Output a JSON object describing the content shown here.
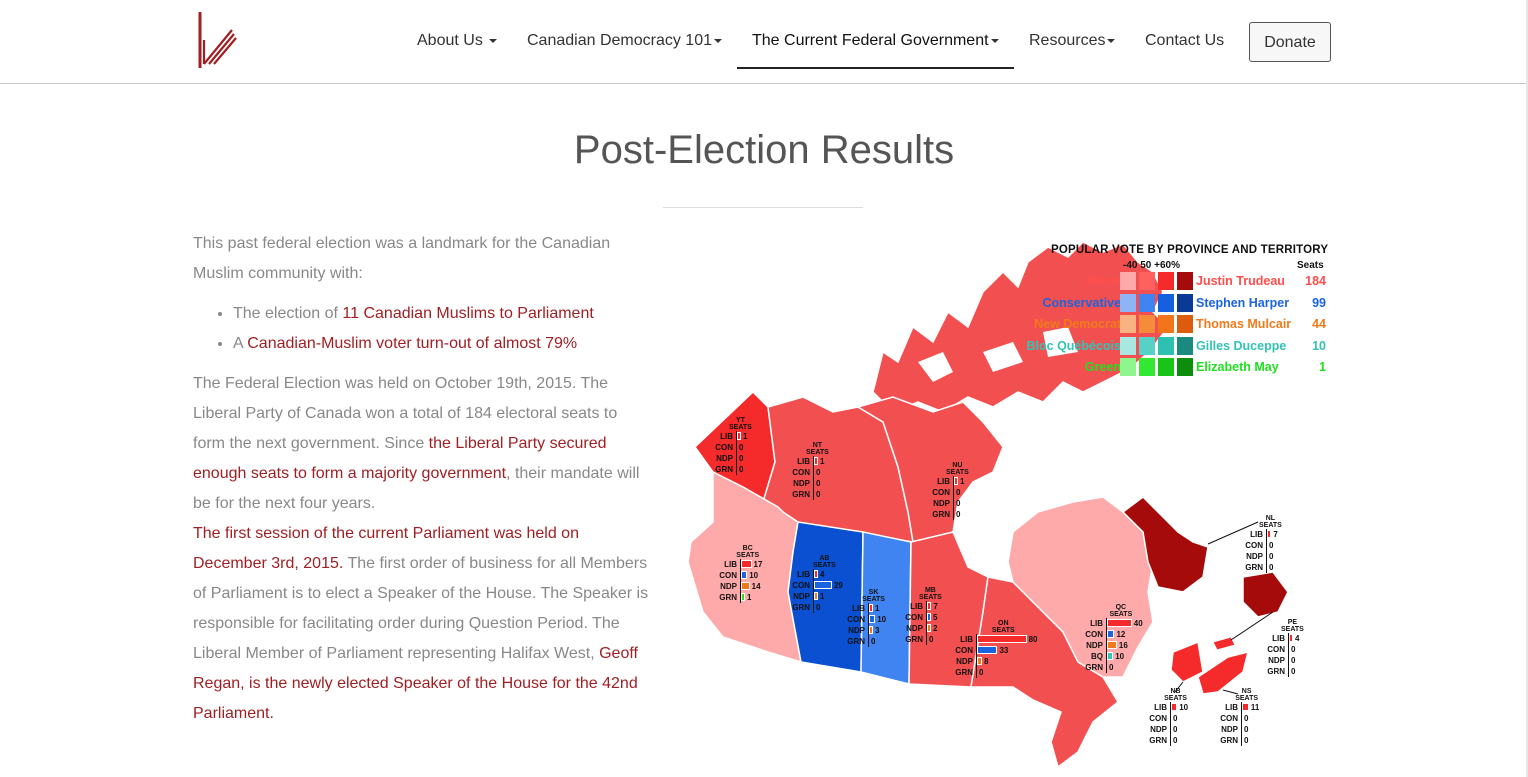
{
  "nav": {
    "items": [
      {
        "label": "About Us",
        "caret": true
      },
      {
        "label": "Canadian Democracy 101",
        "caret": true
      },
      {
        "label": "The Current Federal Government",
        "caret": true
      },
      {
        "label": "Resources",
        "caret": true
      },
      {
        "label": "Contact Us",
        "caret": false
      }
    ],
    "donate_label": "Donate",
    "active": "The Current Federal Government"
  },
  "page": {
    "title": "Post-Election Results",
    "intro": "This past federal election was a landmark for the Canadian Muslim community with:",
    "bullets": [
      {
        "prefix": "The election of ",
        "link": "11 Canadian Muslims to Parliament"
      },
      {
        "prefix": "A ",
        "link": "Canadian-Muslim voter turn-out of almost 79%"
      }
    ],
    "para1_a": "The Federal Election was held on October 19th, 2015. The Liberal Party of Canada won a total of 184 electoral seats to form the next government. Since ",
    "para1_link": "the Liberal Party secured enough seats to form a majority government",
    "para1_b": ", their mandate will be for the next four years.",
    "para2_link": "The first session of the current Parliament was held on December 3rd, 2015.",
    "para2_a": " The first order of business for all Members of Parliament is to elect a Speaker of the House. The Speaker is responsible for facilitating order during Question Period. The Liberal Member of Parliament representing Halifax West, ",
    "para2_link2": "Geoff Regan, is the newly elected Speaker of the House for the 42nd Parliament."
  },
  "map": {
    "legend_title": "POPULAR VOTE BY PROVINCE AND TERRITORY",
    "scale_label": "-40  50  +60%",
    "seats_header": "Seats",
    "parties": [
      {
        "party": "Liberal",
        "leader": "Justin Trudeau",
        "seats": "184",
        "color": "#ff4d4d",
        "shades": [
          "#ffaaaa",
          "#ff6060",
          "#f52a2a",
          "#a50b0b"
        ]
      },
      {
        "party": "Conservative",
        "leader": "Stephen Harper",
        "seats": "99",
        "color": "#1a64e0",
        "shades": [
          "#8fb4f5",
          "#3f84f0",
          "#1560de",
          "#0b3a96"
        ]
      },
      {
        "party": "New Democrat",
        "leader": "Thomas Mulcair",
        "seats": "44",
        "color": "#f07a1a",
        "shades": [
          "#f9b383",
          "#f58c3a",
          "#f3751b",
          "#dc5c0d"
        ]
      },
      {
        "party": "Bloc Québécois",
        "leader": "Gilles Duceppe",
        "seats": "10",
        "color": "#33c3b5",
        "shades": [
          "#a8e8e1",
          "#55d2c5",
          "#2ec0b0",
          "#1b8a7e"
        ]
      },
      {
        "party": "Green",
        "leader": "Elizabeth May",
        "seats": "1",
        "color": "#20e020",
        "shades": [
          "#8ff58f",
          "#33e833",
          "#18c418",
          "#0c8e0c"
        ]
      }
    ],
    "regions": [
      {
        "code": "YT",
        "rows": [
          [
            "LIB",
            "1"
          ],
          [
            "CON",
            "0"
          ],
          [
            "NDP",
            "0"
          ],
          [
            "GRN",
            "0"
          ]
        ]
      },
      {
        "code": "NT",
        "rows": [
          [
            "LIB",
            "1"
          ],
          [
            "CON",
            "0"
          ],
          [
            "NDP",
            "0"
          ],
          [
            "GRN",
            "0"
          ]
        ]
      },
      {
        "code": "NU",
        "rows": [
          [
            "LIB",
            "1"
          ],
          [
            "CON",
            "0"
          ],
          [
            "NDP",
            "0"
          ],
          [
            "GRN",
            "0"
          ]
        ]
      },
      {
        "code": "BC",
        "rows": [
          [
            "LIB",
            "17"
          ],
          [
            "CON",
            "10"
          ],
          [
            "NDP",
            "14"
          ],
          [
            "GRN",
            "1"
          ]
        ]
      },
      {
        "code": "AB",
        "rows": [
          [
            "LIB",
            "4"
          ],
          [
            "CON",
            "29"
          ],
          [
            "NDP",
            "1"
          ],
          [
            "GRN",
            "0"
          ]
        ]
      },
      {
        "code": "SK",
        "rows": [
          [
            "LIB",
            "1"
          ],
          [
            "CON",
            "10"
          ],
          [
            "NDP",
            "3"
          ],
          [
            "GRN",
            "0"
          ]
        ]
      },
      {
        "code": "MB",
        "rows": [
          [
            "LIB",
            "7"
          ],
          [
            "CON",
            "5"
          ],
          [
            "NDP",
            "2"
          ],
          [
            "GRN",
            "0"
          ]
        ]
      },
      {
        "code": "ON",
        "rows": [
          [
            "LIB",
            "80"
          ],
          [
            "CON",
            "33"
          ],
          [
            "NDP",
            "8"
          ],
          [
            "GRN",
            "0"
          ]
        ]
      },
      {
        "code": "QC",
        "rows": [
          [
            "LIB",
            "40"
          ],
          [
            "CON",
            "12"
          ],
          [
            "NDP",
            "16"
          ],
          [
            "BQ",
            "10"
          ],
          [
            "GRN",
            "0"
          ]
        ]
      },
      {
        "code": "NL",
        "rows": [
          [
            "LIB",
            "7"
          ],
          [
            "CON",
            "0"
          ],
          [
            "NDP",
            "0"
          ],
          [
            "GRN",
            "0"
          ]
        ]
      },
      {
        "code": "PE",
        "rows": [
          [
            "LIB",
            "4"
          ],
          [
            "CON",
            "0"
          ],
          [
            "NDP",
            "0"
          ],
          [
            "GRN",
            "0"
          ]
        ]
      },
      {
        "code": "NB",
        "rows": [
          [
            "LIB",
            "10"
          ],
          [
            "CON",
            "0"
          ],
          [
            "NDP",
            "0"
          ],
          [
            "GRN",
            "0"
          ]
        ]
      },
      {
        "code": "NS",
        "rows": [
          [
            "LIB",
            "11"
          ],
          [
            "CON",
            "0"
          ],
          [
            "NDP",
            "0"
          ],
          [
            "GRN",
            "0"
          ]
        ]
      }
    ],
    "seats_label": "SEATS"
  }
}
